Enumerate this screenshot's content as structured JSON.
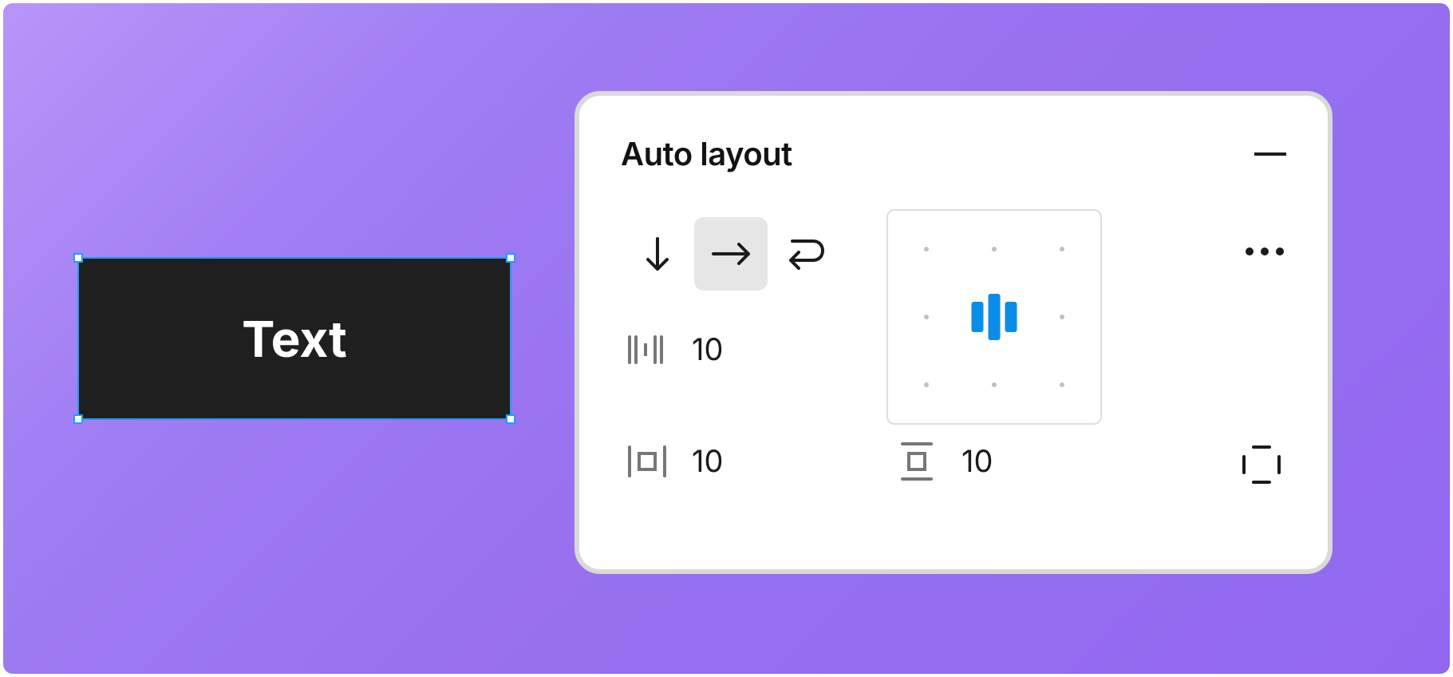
{
  "object": {
    "label": "Text"
  },
  "panel": {
    "title": "Auto layout",
    "values": {
      "gap": "10",
      "horizontal_padding": "10",
      "vertical_padding": "10"
    },
    "colors": {
      "accent": "#0c8ce9"
    }
  }
}
